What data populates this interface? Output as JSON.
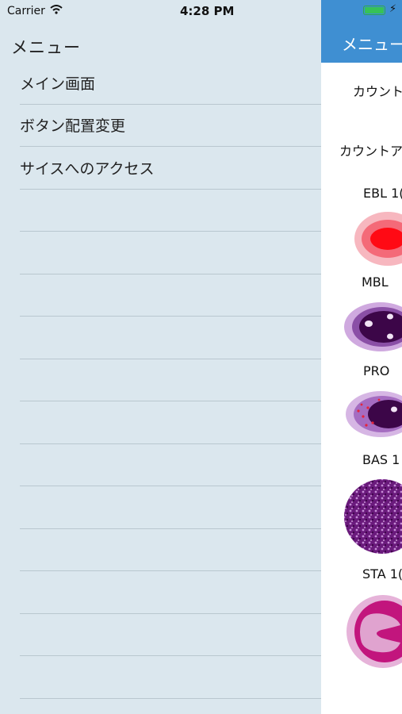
{
  "status": {
    "carrier": "Carrier",
    "time": "4:28 PM"
  },
  "menu": {
    "title": "メニュー",
    "items": [
      {
        "label": "メイン画面"
      },
      {
        "label": "ボタン配置変更"
      },
      {
        "label": "サイスへのアクセス"
      }
    ]
  },
  "main": {
    "header_title": "メニュー",
    "count_label_1": "カウント",
    "count_label_2": "カウントア",
    "cells": [
      {
        "label": "EBL 1("
      },
      {
        "label": "MBL"
      },
      {
        "label": "PRO"
      },
      {
        "label": "BAS 1"
      },
      {
        "label": "STA 1("
      }
    ]
  },
  "colors": {
    "menu_background": "#dbe7ee",
    "header_blue": "#3f8fd2",
    "battery_green": "#36c257"
  }
}
